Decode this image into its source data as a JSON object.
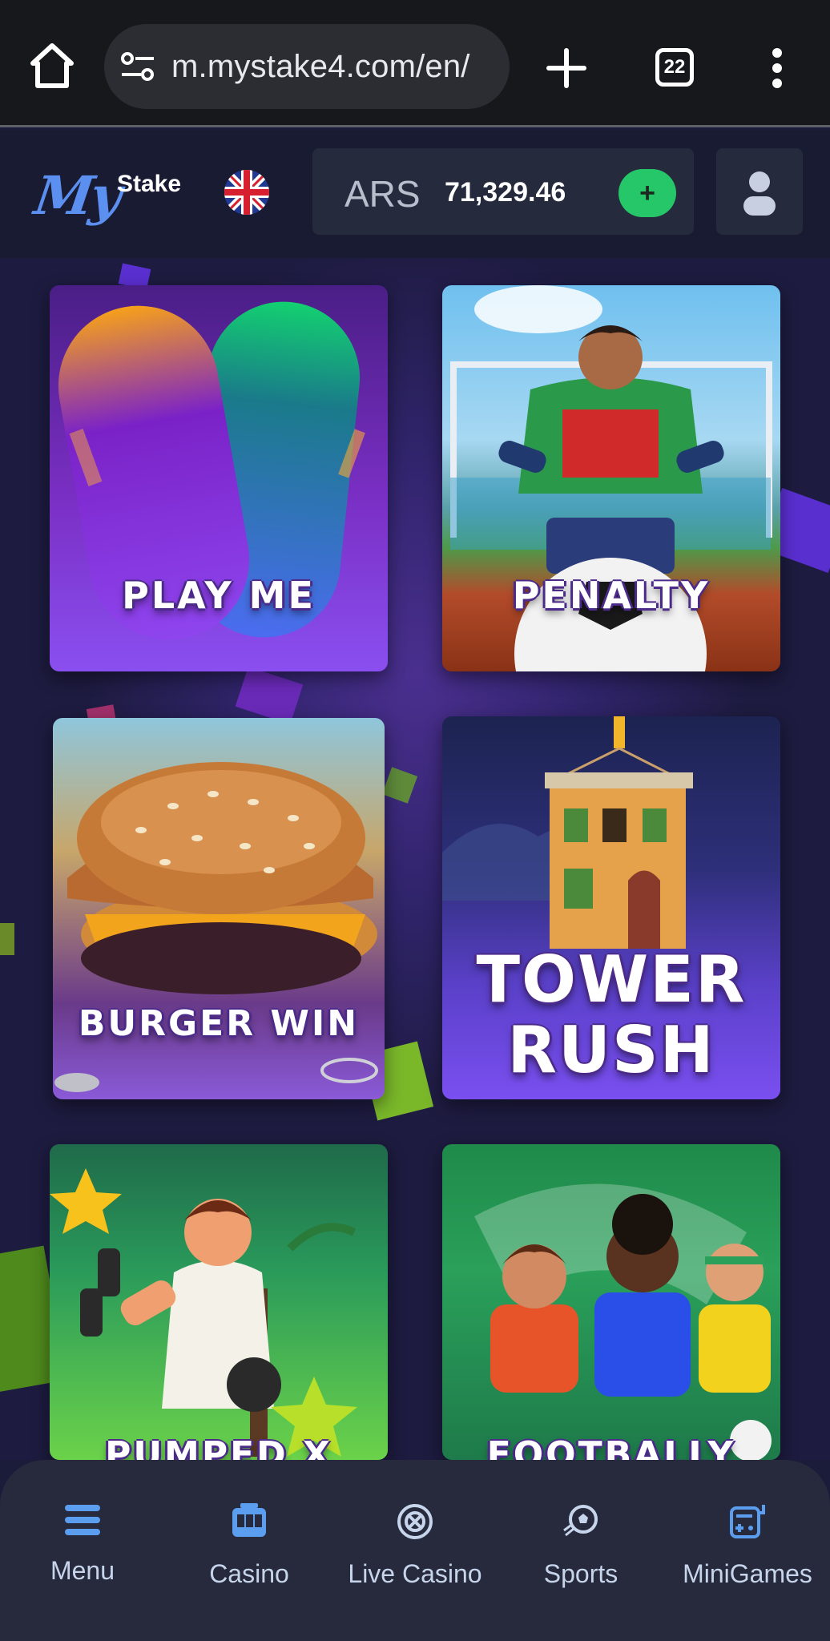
{
  "browser": {
    "url": "m.mystake4.com/en/",
    "tab_count": "22"
  },
  "header": {
    "logo_text": "Stake",
    "logo_script": "My",
    "currency": "ARS",
    "balance": "71,329.46",
    "deposit_label": "+"
  },
  "games": [
    {
      "title": "PLAY ME"
    },
    {
      "title": "PENALTY"
    },
    {
      "title": "BURGER WIN"
    },
    {
      "title_line1": "TOWER",
      "title_line2": "RUSH"
    },
    {
      "title": "PUMPED X"
    },
    {
      "title": "FOOTBALLY"
    }
  ],
  "bottom_nav": [
    {
      "label": "Menu",
      "icon": "menu-icon"
    },
    {
      "label": "Casino",
      "icon": "slot-machine-icon"
    },
    {
      "label": "Live Casino",
      "icon": "roulette-icon"
    },
    {
      "label": "Sports",
      "icon": "soccer-ball-icon"
    },
    {
      "label": "MiniGames",
      "icon": "gamepad-icon"
    }
  ],
  "colors": {
    "accent_blue": "#5b9ef0",
    "deposit_green": "#25c768",
    "nav_background": "#262a3c"
  }
}
